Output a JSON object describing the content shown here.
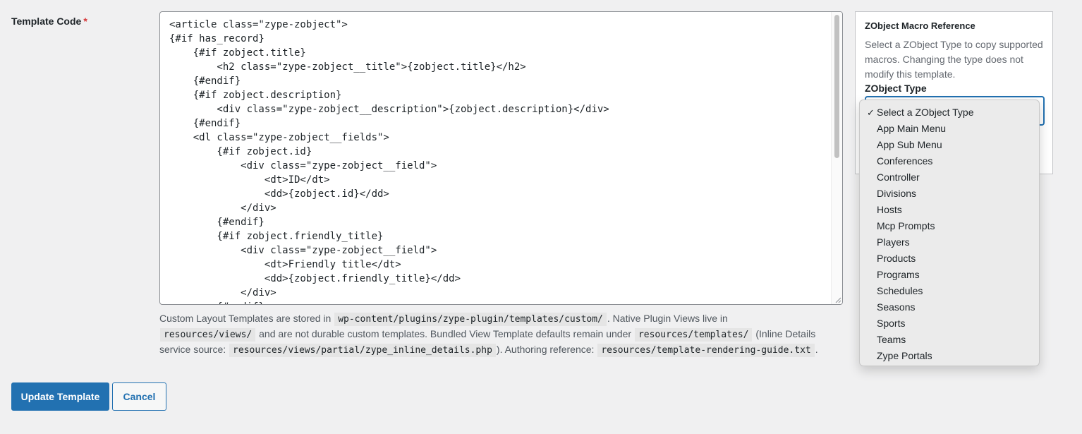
{
  "form": {
    "label": "Template Code",
    "required_mark": "*"
  },
  "code_lines": [
    "<article class=\"zype-zobject\">",
    "{#if has_record}",
    "    {#if zobject.title}",
    "        <h2 class=\"zype-zobject__title\">{zobject.title}</h2>",
    "    {#endif}",
    "    {#if zobject.description}",
    "        <div class=\"zype-zobject__description\">{zobject.description}</div>",
    "    {#endif}",
    "    <dl class=\"zype-zobject__fields\">",
    "        {#if zobject.id}",
    "            <div class=\"zype-zobject__field\">",
    "                <dt>ID</dt>",
    "                <dd>{zobject.id}</dd>",
    "            </div>",
    "        {#endif}",
    "        {#if zobject.friendly_title}",
    "            <div class=\"zype-zobject__field\">",
    "                <dt>Friendly title</dt>",
    "                <dd>{zobject.friendly_title}</dd>",
    "            </div>",
    "        {#endif}"
  ],
  "help": {
    "t1": "Custom Layout Templates are stored in",
    "c1": "wp-content/plugins/zype-plugin/templates/custom/",
    "t2": ". Native Plugin Views live in",
    "c2": "resources/views/",
    "t3": "and are not durable custom templates. Bundled View Template defaults remain under",
    "c3": "resources/templates/",
    "t4": "(Inline Details service source:",
    "c4": "resources/views/partial/zype_inline_details.php",
    "t5": "). Authoring reference:",
    "c5": "resources/template-rendering-guide.txt",
    "t6": "."
  },
  "macro_panel": {
    "title": "ZObject Macro Reference",
    "description": "Select a ZObject Type to copy supported macros. Changing the type does not modify this template.",
    "type_label": "ZObject Type"
  },
  "dropdown": {
    "selected_index": 0,
    "check_mark": "✓",
    "options": [
      "Select a ZObject Type",
      "App Main Menu",
      "App Sub Menu",
      "Conferences",
      "Controller",
      "Divisions",
      "Hosts",
      "Mcp Prompts",
      "Players",
      "Products",
      "Programs",
      "Schedules",
      "Seasons",
      "Sports",
      "Teams",
      "Zype Portals"
    ]
  },
  "actions": {
    "update_label": "Update Template",
    "cancel_label": "Cancel"
  },
  "colors": {
    "primary": "#2271b1",
    "required": "#d63638",
    "page_background": "#f0f0f1"
  }
}
